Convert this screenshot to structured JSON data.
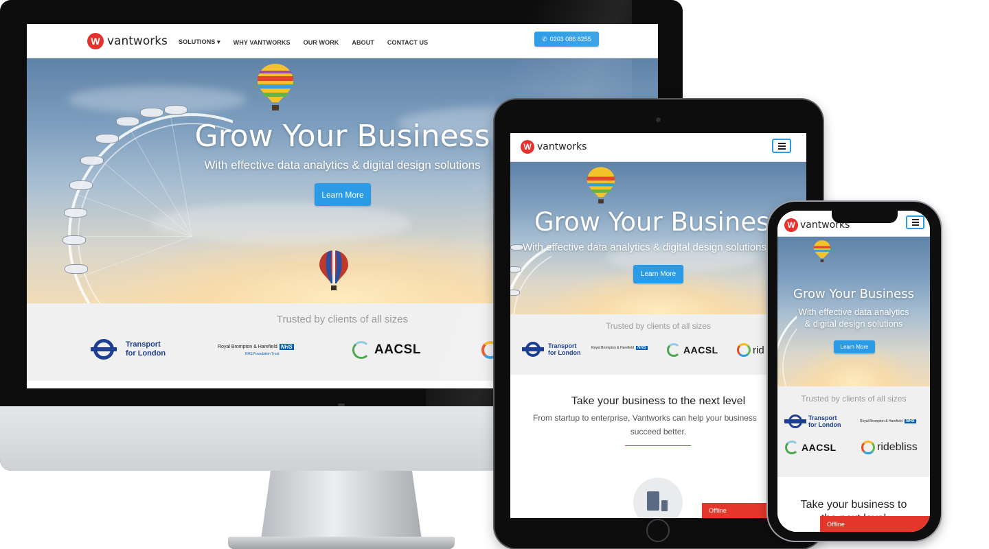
{
  "brand": {
    "name": "vantworks",
    "mark": "W",
    "color": "#e5322d",
    "accent": "#2b9be6"
  },
  "nav": {
    "items": [
      {
        "label": "SOLUTIONS",
        "has_dropdown": true
      },
      {
        "label": "WHY VANTWORKS"
      },
      {
        "label": "OUR WORK"
      },
      {
        "label": "ABOUT"
      },
      {
        "label": "CONTACT US"
      }
    ],
    "dropdown_caret": "▾",
    "phone": "0203 086 8255",
    "phone_icon": "phone-icon"
  },
  "hero": {
    "title": "Grow Your Business",
    "subtitle": "With effective data analytics & digital design solutions",
    "subtitle_line1": "With effective data analytics",
    "subtitle_line2": "& digital design solutions",
    "cta": "Learn More"
  },
  "trusted": {
    "heading": "Trusted by clients of all sizes",
    "clients": {
      "tfl_line1": "Transport",
      "tfl_line2": "for London",
      "nhs_name": "Royal Brompton & Harefield",
      "nhs_badge": "NHS",
      "nhs_trust": "NHS Foundation Trust",
      "aacsl": "AACSL",
      "ridebliss": "ridebliss",
      "ridebliss_partial": "rid"
    }
  },
  "section": {
    "heading": "Take your business to the next level",
    "body_line1": "From startup to enterprise, Vantworks can help your business",
    "body_line2": "succeed better.",
    "phone_heading_line1": "Take your business to",
    "phone_heading_line2": "the next level"
  },
  "status": {
    "offline": "Offline"
  }
}
